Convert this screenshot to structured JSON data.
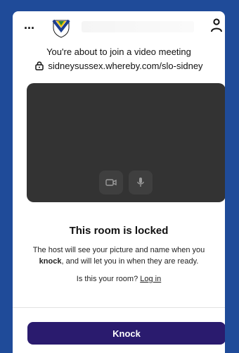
{
  "header": {
    "menu_label": "...",
    "logo_icon": "crest-shield-icon",
    "account_icon": "user-icon"
  },
  "intro": {
    "title": "You're about to join a video meeting",
    "room_url": "sidneysussex.whereby.com/slo-sidney"
  },
  "preview": {
    "camera_icon": "camera-icon",
    "mic_icon": "microphone-icon"
  },
  "locked": {
    "title": "This room is locked",
    "desc_part1": "The host will see your picture and name when you ",
    "desc_bold": "knock",
    "desc_part2": ", and will let you in when they are ready.",
    "own_room_question": "Is this your room?",
    "login_link": "Log in"
  },
  "actions": {
    "knock_label": "Knock"
  },
  "colors": {
    "page_background": "#1f4b99",
    "preview_background": "#333333",
    "knock_button": "#2a1b6e"
  }
}
